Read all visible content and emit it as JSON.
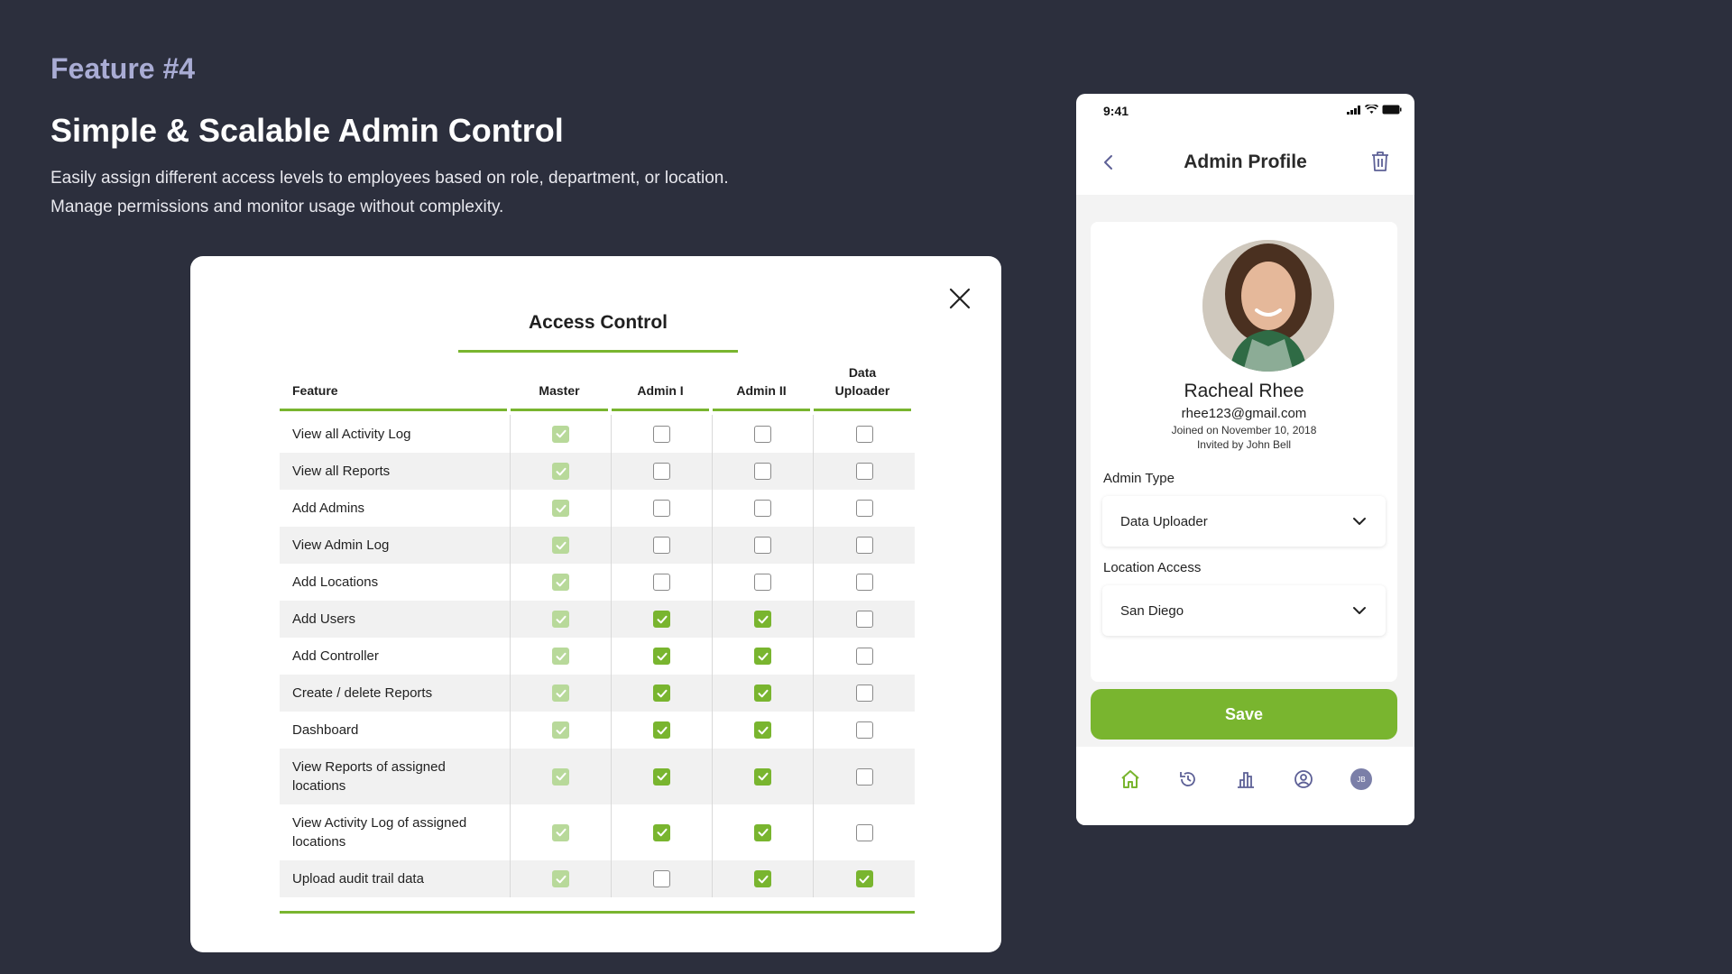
{
  "feature_tag": "Feature #4",
  "headline": "Simple & Scalable Admin Control",
  "description": "Easily assign different access levels to employees based on role, department, or location.\n Manage permissions and monitor usage without complexity.",
  "colors": {
    "background": "#2c2f3d",
    "accent": "#79b52f",
    "accent_light": "#b8d99a",
    "feature_tag": "#a9acd4"
  },
  "access_control": {
    "title": "Access Control",
    "close_icon": "close-icon",
    "columns": [
      "Feature",
      "Master",
      "Admin I",
      "Admin II",
      "Data\nUploader"
    ],
    "rows": [
      {
        "feature": "View all Activity Log",
        "master": "light",
        "admin1": "off",
        "admin2": "off",
        "uploader": "off"
      },
      {
        "feature": "View all Reports",
        "master": "light",
        "admin1": "off",
        "admin2": "off",
        "uploader": "off"
      },
      {
        "feature": "Add Admins",
        "master": "light",
        "admin1": "off",
        "admin2": "off",
        "uploader": "off"
      },
      {
        "feature": "View Admin Log",
        "master": "light",
        "admin1": "off",
        "admin2": "off",
        "uploader": "off"
      },
      {
        "feature": "Add Locations",
        "master": "light",
        "admin1": "off",
        "admin2": "off",
        "uploader": "off"
      },
      {
        "feature": "Add Users",
        "master": "light",
        "admin1": "on",
        "admin2": "on",
        "uploader": "off"
      },
      {
        "feature": "Add Controller",
        "master": "light",
        "admin1": "on",
        "admin2": "on",
        "uploader": "off"
      },
      {
        "feature": "Create / delete Reports",
        "master": "light",
        "admin1": "on",
        "admin2": "on",
        "uploader": "off"
      },
      {
        "feature": "Dashboard",
        "master": "light",
        "admin1": "on",
        "admin2": "on",
        "uploader": "off"
      },
      {
        "feature": "View Reports of assigned\nlocations",
        "master": "light",
        "admin1": "on",
        "admin2": "on",
        "uploader": "off"
      },
      {
        "feature": "View Activity Log of assigned\nlocations",
        "master": "light",
        "admin1": "on",
        "admin2": "on",
        "uploader": "off"
      },
      {
        "feature": "Upload audit trail data",
        "master": "light",
        "admin1": "off",
        "admin2": "on",
        "uploader": "on"
      }
    ]
  },
  "phone": {
    "status_time": "9:41",
    "nav": {
      "title": "Admin Profile",
      "back_icon": "chevron-left-icon",
      "delete_icon": "trash-icon"
    },
    "profile": {
      "name": "Racheal Rhee",
      "email": "rhee123@gmail.com",
      "joined": "Joined on November 10, 2018",
      "invited": "Invited by John Bell"
    },
    "admin_type": {
      "label": "Admin Type",
      "value": "Data Uploader"
    },
    "location_access": {
      "label": "Location Access",
      "value": "San Diego"
    },
    "save_label": "Save",
    "tabbar": {
      "items": [
        "home-icon",
        "history-icon",
        "chart-icon",
        "profile-icon",
        "avatar"
      ],
      "avatar_initials": "JB"
    }
  }
}
